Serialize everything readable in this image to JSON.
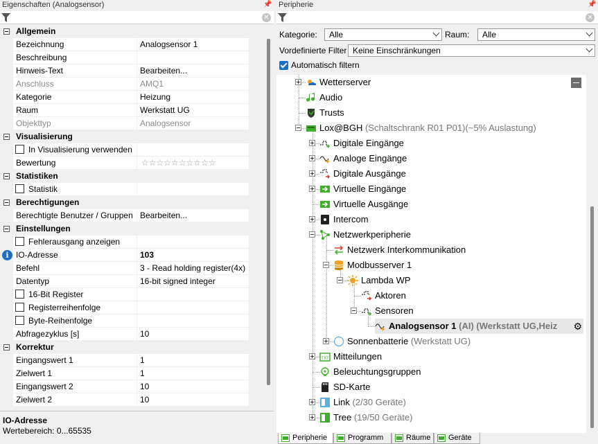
{
  "left_panel": {
    "title": "Eigenschaften (Analogsensor)",
    "pin": "📌",
    "clear": "✕",
    "rows": [
      {
        "type": "cat",
        "name": "Allgemein"
      },
      {
        "type": "prop",
        "name": "Bezeichnung",
        "value": "Analogsensor 1"
      },
      {
        "type": "prop",
        "name": "Beschreibung",
        "value": ""
      },
      {
        "type": "prop",
        "name": "Hinweis-Text",
        "value": "Bearbeiten..."
      },
      {
        "type": "dis",
        "name": "Anschluss",
        "value": "AMQ1"
      },
      {
        "type": "prop",
        "name": "Kategorie",
        "value": "Heizung"
      },
      {
        "type": "prop",
        "name": "Raum",
        "value": "Werkstatt UG"
      },
      {
        "type": "dis",
        "name": "Objekttyp",
        "value": "Analogsensor"
      },
      {
        "type": "cat",
        "name": "Visualisierung"
      },
      {
        "type": "check",
        "name": "In Visualisierung verwenden",
        "value": ""
      },
      {
        "type": "stars",
        "name": "Bewertung",
        "value": "☆☆☆☆☆☆☆☆☆☆"
      },
      {
        "type": "cat",
        "name": "Statistiken"
      },
      {
        "type": "check",
        "name": "Statistik",
        "value": ""
      },
      {
        "type": "cat",
        "name": "Berechtigungen"
      },
      {
        "type": "prop",
        "name": "Berechtigte Benutzer / Gruppen",
        "value": "Bearbeiten..."
      },
      {
        "type": "cat",
        "name": "Einstellungen"
      },
      {
        "type": "check",
        "name": "Fehlerausgang anzeigen",
        "value": ""
      },
      {
        "type": "info",
        "name": "IO-Adresse",
        "value": "103"
      },
      {
        "type": "prop",
        "name": "Befehl",
        "value": "3 - Read holding register(4x)"
      },
      {
        "type": "prop",
        "name": "Datentyp",
        "value": "16-bit signed integer"
      },
      {
        "type": "check",
        "name": "16-Bit Register",
        "value": ""
      },
      {
        "type": "check",
        "name": "Registerreihenfolge",
        "value": ""
      },
      {
        "type": "check",
        "name": "Byte-Reihenfolge",
        "value": ""
      },
      {
        "type": "prop",
        "name": "Abfragezyklus [s]",
        "value": "10"
      },
      {
        "type": "cat",
        "name": "Korrektur"
      },
      {
        "type": "prop",
        "name": "Eingangswert 1",
        "value": "1"
      },
      {
        "type": "prop",
        "name": "Zielwert 1",
        "value": "1"
      },
      {
        "type": "prop",
        "name": "Eingangswert 2",
        "value": "10"
      },
      {
        "type": "prop",
        "name": "Zielwert 2",
        "value": "10"
      }
    ],
    "description": {
      "title": "IO-Adresse",
      "text": "Wertebereich: 0...65535"
    }
  },
  "right_panel": {
    "title": "Peripherie",
    "pin": "📌",
    "clear": "✕",
    "kategorie_label": "Kategorie:",
    "kategorie_value": "Alle",
    "raum_label": "Raum:",
    "raum_value": "Alle",
    "filter_label": "Vordefinierte Filter",
    "filter_value": "Keine Einschränkungen",
    "auto_filter_label": "Automatisch filtern",
    "tree": [
      {
        "label": "Wetterserver",
        "sub": "",
        "icon": "weather-icon"
      },
      {
        "label": "Audio",
        "sub": "",
        "icon": "music-note-icon"
      },
      {
        "label": "Trusts",
        "sub": "",
        "icon": "trust-icon"
      },
      {
        "label": "Lox@BGH",
        "sub": "(Schaltschrank R01 P01)(~5% Auslastung)",
        "icon": "miniserver-icon"
      },
      {
        "label": "Digitale Eingänge",
        "sub": "",
        "icon": "digital-input-icon"
      },
      {
        "label": "Analoge Eingänge",
        "sub": "",
        "icon": "analog-input-icon"
      },
      {
        "label": "Digitale Ausgänge",
        "sub": "",
        "icon": "digital-output-icon"
      },
      {
        "label": "Virtuelle Eingänge",
        "sub": "",
        "icon": "virtual-input-icon"
      },
      {
        "label": "Virtuelle Ausgänge",
        "sub": "",
        "icon": "virtual-output-icon"
      },
      {
        "label": "Intercom",
        "sub": "",
        "icon": "intercom-icon"
      },
      {
        "label": "Netzwerkperipherie",
        "sub": "",
        "icon": "network-icon"
      },
      {
        "label": "Netzwerk Interkommunikation",
        "sub": "",
        "icon": "intercommunication-icon"
      },
      {
        "label": "Modbusserver 1",
        "sub": "",
        "icon": "modbus-server-icon"
      },
      {
        "label": "Lambda WP",
        "sub": "",
        "icon": "heatpump-icon"
      },
      {
        "label": "Aktoren",
        "sub": "",
        "icon": "actuator-icon"
      },
      {
        "label": "Sensoren",
        "sub": "",
        "icon": "sensor-icon"
      },
      {
        "label": "Analogsensor 1",
        "sub": "(AI) (Werkstatt UG,Heiz",
        "icon": "analog-sensor-icon"
      },
      {
        "label": "Sonnenbatterie",
        "sub": "(Werkstatt UG)",
        "icon": "battery-icon"
      },
      {
        "label": "Mitteilungen",
        "sub": "",
        "icon": "messages-icon"
      },
      {
        "label": "Beleuchtungsgruppen",
        "sub": "",
        "icon": "lighting-icon"
      },
      {
        "label": "SD-Karte",
        "sub": "",
        "icon": "sd-card-icon"
      },
      {
        "label": "Link",
        "sub": "(2/30 Geräte)",
        "icon": "link-icon"
      },
      {
        "label": "Tree",
        "sub": "(19/50 Geräte)",
        "icon": "tree-icon"
      }
    ],
    "tabs": [
      "Peripherie",
      "Programm",
      "Räume",
      "Geräte"
    ]
  },
  "colors": {
    "accent": "#1a6fc9",
    "green": "#3fae2a",
    "orange": "#f0a020",
    "red": "#d83a2a"
  }
}
